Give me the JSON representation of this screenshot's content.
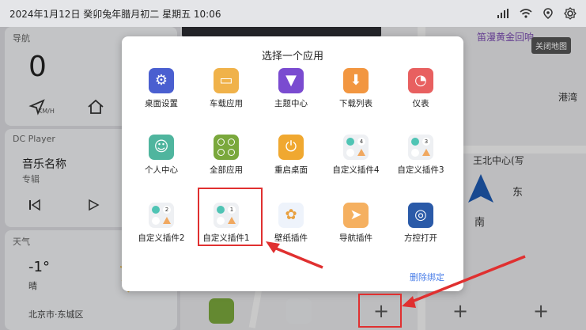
{
  "status": {
    "datetime": "2024年1月12日  癸卯兔年腊月初二  星期五  10:06"
  },
  "nav_card": {
    "title": "导航",
    "speed": "0",
    "unit": "KM/H"
  },
  "player_card": {
    "title": "DC Player",
    "song": "音乐名称",
    "album": "专辑"
  },
  "weather_card": {
    "title": "天气",
    "temp": "-1°",
    "condition": "晴",
    "city": "北京市·东城区"
  },
  "map": {
    "poi1": "笛漫黄金回响",
    "poi2": "港湾",
    "poi3": "王北中心(写",
    "dir_east": "东",
    "dir_south": "南",
    "tooltip": "关闭地图"
  },
  "dialog": {
    "title": "选择一个应用",
    "unbind": "删除绑定",
    "apps": [
      {
        "label": "桌面设置",
        "icon": "gear-icon",
        "color": "#4a5fd0"
      },
      {
        "label": "车载应用",
        "icon": "bag-icon",
        "color": "#f0b24a"
      },
      {
        "label": "主题中心",
        "icon": "shirt-icon",
        "color": "#7a4bd0"
      },
      {
        "label": "下载列表",
        "icon": "download-icon",
        "color": "#f29640"
      },
      {
        "label": "仪表",
        "icon": "gauge-icon",
        "color": "#e86060"
      },
      {
        "label": "个人中心",
        "icon": "person-icon",
        "color": "#4fb59e"
      },
      {
        "label": "全部应用",
        "icon": "apps-icon",
        "color": "#7aa83c"
      },
      {
        "label": "重启桌面",
        "icon": "power-icon",
        "color": "#f0a830"
      },
      {
        "label": "自定义插件4",
        "icon": "plugin-icon",
        "badge": "4"
      },
      {
        "label": "自定义插件3",
        "icon": "plugin-icon",
        "badge": "3"
      },
      {
        "label": "自定义插件2",
        "icon": "plugin-icon",
        "badge": "2"
      },
      {
        "label": "自定义插件1",
        "icon": "plugin-icon",
        "badge": "1"
      },
      {
        "label": "壁纸插件",
        "icon": "palette-icon",
        "color": "#eef3fb"
      },
      {
        "label": "导航插件",
        "icon": "navigate-icon",
        "color": "#f5b060"
      },
      {
        "label": "方控打开",
        "icon": "steering-wheel-icon",
        "color": "#2a5aa8"
      }
    ]
  },
  "dock": {
    "plus": "+"
  }
}
